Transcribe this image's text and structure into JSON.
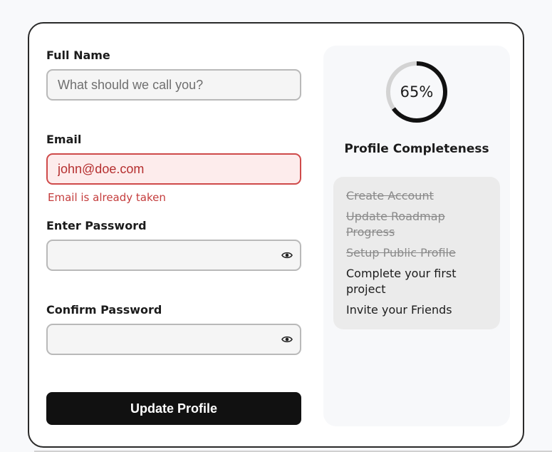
{
  "form": {
    "full_name": {
      "label": "Full Name",
      "value": "",
      "placeholder": "What should we call you?"
    },
    "email": {
      "label": "Email",
      "value": "john@doe.com",
      "placeholder": "",
      "error": "Email is already taken"
    },
    "password": {
      "label": "Enter Password",
      "value": "",
      "toggle_icon": "eye-icon"
    },
    "confirm_password": {
      "label": "Confirm Password",
      "value": "",
      "toggle_icon": "eye-icon"
    },
    "submit_label": "Update Profile"
  },
  "completeness": {
    "percent_value": 65,
    "percent_label": "65%",
    "title": "Profile Completeness",
    "ring_color": "#111111",
    "ring_track_color": "#d3d3d3",
    "checklist": [
      {
        "label": "Create Account",
        "done": true
      },
      {
        "label": "Update Roadmap Progress",
        "done": true
      },
      {
        "label": "Setup Public Profile",
        "done": true
      },
      {
        "label": "Complete your first project",
        "done": false
      },
      {
        "label": "Invite your Friends",
        "done": false
      }
    ]
  },
  "colors": {
    "error": "#c43c3c",
    "error_background": "#fdecec",
    "button": "#111111"
  }
}
